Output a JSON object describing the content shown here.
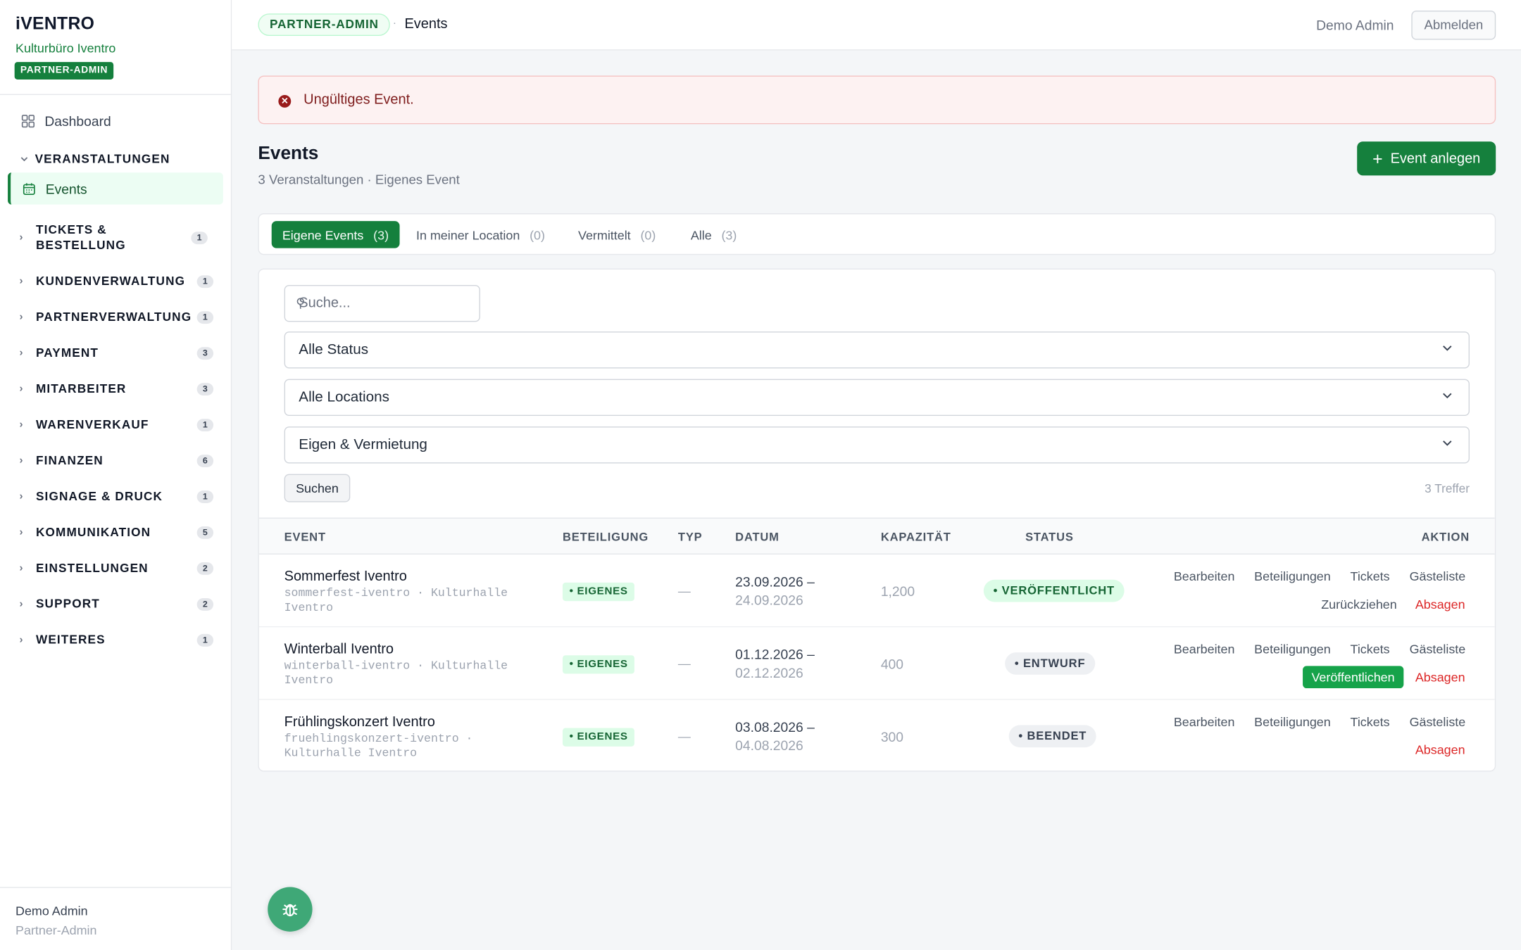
{
  "brand": {
    "logo": "iVENTRO",
    "organization": "Kulturbüro Iventro",
    "role_badge": "PARTNER-ADMIN"
  },
  "sidebar": {
    "dashboard": "Dashboard",
    "open_group": "VERANSTALTUNGEN",
    "active_item": "Events",
    "groups": [
      {
        "label": "TICKETS & BESTELLUNG",
        "count": "1"
      },
      {
        "label": "KUNDENVERWALTUNG",
        "count": "1"
      },
      {
        "label": "PARTNERVERWALTUNG",
        "count": "1"
      },
      {
        "label": "PAYMENT",
        "count": "3"
      },
      {
        "label": "MITARBEITER",
        "count": "3"
      },
      {
        "label": "WARENVERKAUF",
        "count": "1"
      },
      {
        "label": "FINANZEN",
        "count": "6"
      },
      {
        "label": "SIGNAGE & DRUCK",
        "count": "1"
      },
      {
        "label": "KOMMUNIKATION",
        "count": "5"
      },
      {
        "label": "EINSTELLUNGEN",
        "count": "2"
      },
      {
        "label": "SUPPORT",
        "count": "2"
      },
      {
        "label": "WEITERES",
        "count": "1"
      }
    ],
    "user_name": "Demo Admin",
    "user_role": "Partner-Admin"
  },
  "topbar": {
    "badge": "PARTNER-ADMIN",
    "separator": "·",
    "title": "Events",
    "user": "Demo Admin",
    "logout": "Abmelden"
  },
  "alert": {
    "icon": "error-circle-icon",
    "text": "Ungültiges Event."
  },
  "page": {
    "title": "Events",
    "subtitle": "3 Veranstaltungen · Eigenes Event",
    "new_button": "Event anlegen"
  },
  "tabs": [
    {
      "label": "Eigene Events",
      "count": "(3)"
    },
    {
      "label": "In meiner Location",
      "count": "(0)"
    },
    {
      "label": "Vermittelt",
      "count": "(0)"
    },
    {
      "label": "Alle",
      "count": "(3)"
    }
  ],
  "filters": {
    "search_placeholder": "Suche...",
    "status": "Alle Status",
    "locations": "Alle Locations",
    "ownership": "Eigen & Vermietung",
    "search_button": "Suchen",
    "hits": "3 Treffer"
  },
  "table": {
    "headers": [
      "EVENT",
      "BETEILIGUNG",
      "TYP",
      "DATUM",
      "KAPAZITÄT",
      "STATUS",
      "AKTION"
    ],
    "rows": [
      {
        "name": "Sommerfest Iventro",
        "slug": "sommerfest-iventro · Kulturhalle Iventro",
        "participation": "• EIGENES",
        "type": "—",
        "date_start": "23.09.2026 –",
        "date_end": "24.09.2026",
        "capacity": "1,200",
        "status": "• VERÖFFENTLICHT",
        "actions": {
          "edit": "Bearbeiten",
          "participations": "Beteiligungen",
          "tickets": "Tickets",
          "guestlist": "Gästeliste",
          "secondary": "Zurückziehen",
          "cancel": "Absagen"
        }
      },
      {
        "name": "Winterball Iventro",
        "slug": "winterball-iventro · Kulturhalle Iventro",
        "participation": "• EIGENES",
        "type": "—",
        "date_start": "01.12.2026 –",
        "date_end": "02.12.2026",
        "capacity": "400",
        "status": "• ENTWURF",
        "actions": {
          "edit": "Bearbeiten",
          "participations": "Beteiligungen",
          "tickets": "Tickets",
          "guestlist": "Gästeliste",
          "secondary": "Veröffentlichen",
          "cancel": "Absagen"
        }
      },
      {
        "name": "Frühlingskonzert Iventro",
        "slug": "fruehlingskonzert-iventro · Kulturhalle Iventro",
        "participation": "• EIGENES",
        "type": "—",
        "date_start": "03.08.2026 –",
        "date_end": "04.08.2026",
        "capacity": "300",
        "status": "• BEENDET",
        "actions": {
          "edit": "Bearbeiten",
          "participations": "Beteiligungen",
          "tickets": "Tickets",
          "guestlist": "Gästeliste",
          "cancel": "Absagen"
        }
      }
    ]
  },
  "fab": {
    "icon": "bug-icon"
  },
  "colors": {
    "accent": "#15803d",
    "danger": "#dc2626",
    "alert_bg": "#fdf2f2"
  }
}
